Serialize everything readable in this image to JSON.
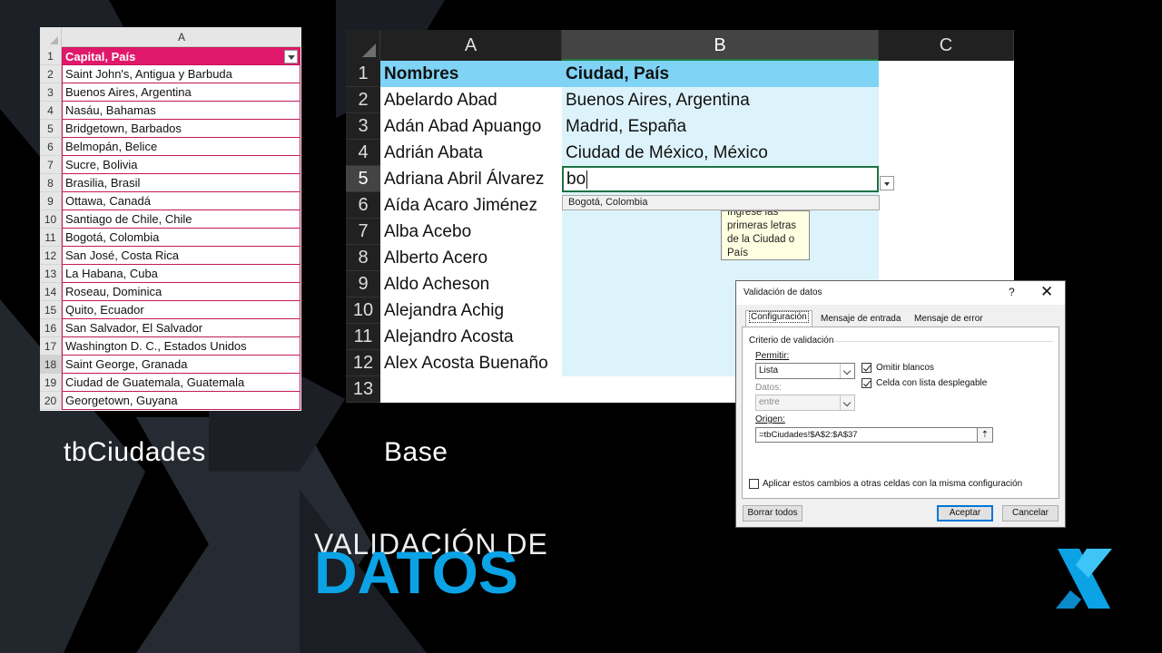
{
  "small_sheet": {
    "column_header": "A",
    "rows": [
      {
        "num": "1",
        "value": "Capital, País",
        "is_header": true
      },
      {
        "num": "2",
        "value": "Saint John's,  Antigua y Barbuda"
      },
      {
        "num": "3",
        "value": "Buenos Aires,  Argentina"
      },
      {
        "num": "4",
        "value": "Nasáu,  Bahamas"
      },
      {
        "num": "5",
        "value": "Bridgetown,  Barbados"
      },
      {
        "num": "6",
        "value": "Belmopán,  Belice"
      },
      {
        "num": "7",
        "value": "Sucre,  Bolivia"
      },
      {
        "num": "8",
        "value": "Brasilia,  Brasil"
      },
      {
        "num": "9",
        "value": "Ottawa,  Canadá"
      },
      {
        "num": "10",
        "value": "Santiago de Chile,  Chile"
      },
      {
        "num": "11",
        "value": "Bogotá,  Colombia"
      },
      {
        "num": "12",
        "value": "San José,  Costa Rica"
      },
      {
        "num": "13",
        "value": "La Habana,  Cuba"
      },
      {
        "num": "14",
        "value": "Roseau,  Dominica"
      },
      {
        "num": "15",
        "value": "Quito,  Ecuador"
      },
      {
        "num": "16",
        "value": "San Salvador,  El Salvador"
      },
      {
        "num": "17",
        "value": "Washington D. C.,  Estados Unidos"
      },
      {
        "num": "18",
        "value": "Saint George,  Granada",
        "selected": true
      },
      {
        "num": "19",
        "value": "Ciudad de Guatemala,  Guatemala"
      },
      {
        "num": "20",
        "value": "Georgetown,  Guyana"
      }
    ],
    "label": "tbCiudades"
  },
  "big_sheet": {
    "column_headers": [
      "A",
      "B",
      "C"
    ],
    "rows": [
      {
        "num": "1",
        "a": "Nombres",
        "b": "Ciudad, País"
      },
      {
        "num": "2",
        "a": "Abelardo Abad",
        "b": "Buenos Aires,  Argentina"
      },
      {
        "num": "3",
        "a": "Adán Abad Apuango",
        "b": "Madrid, España"
      },
      {
        "num": "4",
        "a": "Adrián Abata",
        "b": "Ciudad de México,  México"
      },
      {
        "num": "5",
        "a": "Adriana Abril Álvarez",
        "b": "bo"
      },
      {
        "num": "6",
        "a": "Aída Acaro Jiménez",
        "b": ""
      },
      {
        "num": "7",
        "a": "Alba Acebo",
        "b": ""
      },
      {
        "num": "8",
        "a": "Alberto Acero",
        "b": ""
      },
      {
        "num": "9",
        "a": "Aldo Acheson",
        "b": ""
      },
      {
        "num": "10",
        "a": "Alejandra Achig",
        "b": ""
      },
      {
        "num": "11",
        "a": "Alejandro Acosta",
        "b": ""
      },
      {
        "num": "12",
        "a": "Alex Acosta Buenaño",
        "b": ""
      },
      {
        "num": "13",
        "a": "",
        "b": ""
      }
    ],
    "autocomplete": "Bogotá,  Colombia",
    "tooltip": "Ingrese las primeras letras de la Ciudad o País",
    "label": "Base"
  },
  "dialog": {
    "title": "Validación de datos",
    "help": "?",
    "close": "✕",
    "tabs": [
      "Configuración",
      "Mensaje de entrada",
      "Mensaje de error"
    ],
    "group_title": "Criterio de validación",
    "permitir_label": "Permitir:",
    "permitir_value": "Lista",
    "datos_label": "Datos:",
    "datos_value": "entre",
    "omitir_blancos": "Omitir blancos",
    "celda_lista": "Celda con lista desplegable",
    "origen_label": "Origen:",
    "origen_value": "=tbCiudades!$A$2:$A$37",
    "aplicar": "Aplicar estos cambios a otras celdas con la misma configuración",
    "borrar": "Borrar todos",
    "aceptar": "Aceptar",
    "cancelar": "Cancelar"
  },
  "logo": {
    "line1": "VALIDACIÓN DE",
    "line2": "DATOS"
  },
  "colors": {
    "accent_blue": "#0ba3e6",
    "table_header_pink": "#e0186b",
    "header_blue": "#7fd3f5",
    "light_blue": "#ddf3fb"
  }
}
